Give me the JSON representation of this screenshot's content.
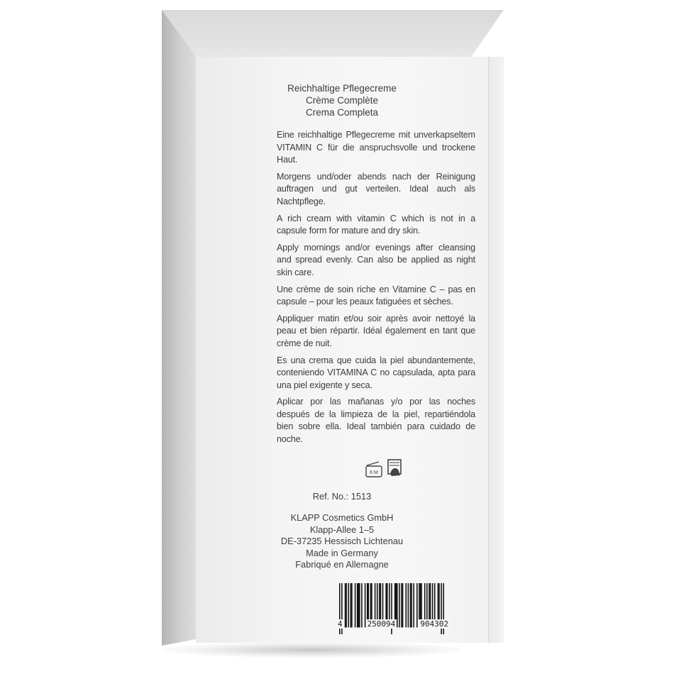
{
  "product_titles": {
    "de": "Reichhaltige Pflegecreme",
    "fr": "Crème Complète",
    "es": "Crema Completa"
  },
  "paragraphs": [
    "Eine reichhaltige Pflegecreme mit unverkapseltem VITAMIN C für die anspruchsvolle und trockene Haut.",
    "Morgens und/oder abends nach der Reinigung auftragen und gut verteilen. Ideal auch als Nachtpflege.",
    "A rich cream with vitamin C which is not in a capsule form for mature and dry skin.",
    "Apply mornings and/or evenings after cleansing and spread evenly. Can also be applied as night skin care.",
    "Une crème de soin riche en Vitamine C – pas en capsule – pour les peaux fatiguées et sèches.",
    "Appliquer matin et/ou soir après avoir nettoyé la peau et bien répartir. Idéal également en tant que crème de nuit.",
    "Es una crema que cuida la piel abundantemente, conteniendo VITAMINA C no capsulada, apta para una piel exigente y seca.",
    "Aplicar por las mañanas y/o por las noches después de la limpieza de la piel, repartiéndola bien sobre ella. Ideal también para cuidado de noche."
  ],
  "symbols": {
    "pao_label": "6 M",
    "pao_icon": "open-jar-icon",
    "book_icon": "refer-to-leaflet-icon"
  },
  "ref": "Ref. No.: 1513",
  "address": [
    "KLAPP Cosmetics GmbH",
    "Klapp-Allee 1–5",
    "DE-37235 Hessisch Lichtenau",
    "Made in Germany",
    "Fabriqué en Allemagne"
  ],
  "barcode": {
    "first": "4",
    "left": "250094",
    "right": "904302"
  }
}
